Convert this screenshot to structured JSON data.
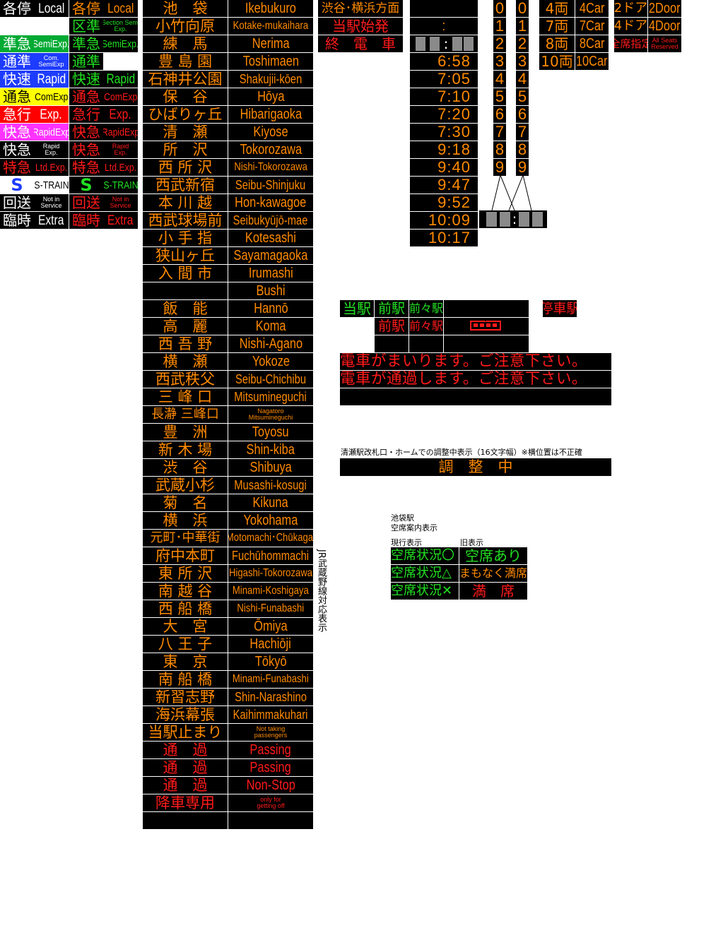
{
  "type_badges": [
    {
      "jp": "各停",
      "en": "Local",
      "jp_bg": "#000000",
      "jp_fg": "#ffffff",
      "en_bg": "#000000",
      "en_fg": "#ffffff",
      "jp_led": "各停",
      "en_led": "Local",
      "led_fg": "#ff8a00"
    },
    {
      "jp": "",
      "en": "",
      "jp_bg": "#000000",
      "jp_fg": "#ffffff",
      "en_bg": "#000000",
      "en_fg": "#ffffff",
      "jp_led": "区準",
      "en_led": "Section Semi Exp.",
      "led_fg": "#22e022"
    },
    {
      "jp": "準急",
      "en": "SemiExp.",
      "jp_bg": "#00aa33",
      "jp_fg": "#ffffff",
      "en_bg": "#00aa33",
      "en_fg": "#ffffff",
      "jp_led": "準急",
      "en_led": "SemiExp.",
      "led_fg": "#22e022"
    },
    {
      "jp": "通準",
      "en": "Com. SemiExp",
      "jp_bg": "#1e3cff",
      "jp_fg": "#ffffff",
      "en_bg": "#1e3cff",
      "en_fg": "#ffffff",
      "jp_led": "通準",
      "en_led": "",
      "led_fg": "#22e022"
    },
    {
      "jp": "快速",
      "en": "Rapid",
      "jp_bg": "#1e3cff",
      "jp_fg": "#ffffff",
      "en_bg": "#1e3cff",
      "en_fg": "#ffffff",
      "jp_led": "快速",
      "en_led": "Rapid",
      "led_fg": "#22e022"
    },
    {
      "jp": "通急",
      "en": "ComExp",
      "jp_bg": "#ffff00",
      "jp_fg": "#000000",
      "en_bg": "#ffff00",
      "en_fg": "#000000",
      "jp_led": "通急",
      "en_led": "ComExp",
      "led_fg": "#ff1a1a"
    },
    {
      "jp": "急行",
      "en": "Exp.",
      "jp_bg": "#ff0000",
      "jp_fg": "#ffffff",
      "en_bg": "#ff0000",
      "en_fg": "#ffffff",
      "jp_led": "急行",
      "en_led": "Exp.",
      "led_fg": "#ff1a1a"
    },
    {
      "jp": "快急",
      "en": "RapidExp",
      "jp_bg": "#ff33ff",
      "jp_fg": "#ffffff",
      "en_bg": "#ff33ff",
      "en_fg": "#ffffff",
      "jp_led": "快急",
      "en_led": "RapidExp",
      "led_fg": "#ff1a1a"
    },
    {
      "jp": "快急",
      "en": "Rapid Exp.",
      "jp_bg": "#000000",
      "jp_fg": "#ffffff",
      "en_bg": "#000000",
      "en_fg": "#ffffff",
      "jp_led": "快急",
      "en_led": "Rapid Exp.",
      "led_fg": "#ff1a1a"
    },
    {
      "jp": "特急",
      "en": "Ltd.Exp.",
      "jp_bg": "#000000",
      "jp_fg": "#ff1a1a",
      "en_bg": "#000000",
      "en_fg": "#ff1a1a",
      "jp_led": "特急",
      "en_led": "Ltd.Exp.",
      "led_fg": "#ff1a1a"
    },
    {
      "jp": "S",
      "en": "S-TRAIN",
      "jp_bg": "#ffffff",
      "jp_fg": "#1e3cff",
      "en_bg": "#ffffff",
      "en_fg": "#000000",
      "jp_led": "S",
      "en_led": "S-TRAIN",
      "led_fg": "#22e022"
    },
    {
      "jp": "回送",
      "en": "Not in Service",
      "jp_bg": "#000000",
      "jp_fg": "#ffffff",
      "en_bg": "#000000",
      "en_fg": "#ffffff",
      "jp_led": "回送",
      "en_led": "Not in Service",
      "led_fg": "#ff1a1a"
    },
    {
      "jp": "臨時",
      "en": "Extra",
      "jp_bg": "#000000",
      "jp_fg": "#ffffff",
      "en_bg": "#000000",
      "en_fg": "#ffffff",
      "jp_led": "臨時",
      "en_led": "Extra",
      "led_fg": "#ff1a1a"
    }
  ],
  "stations": [
    {
      "jp": "池　袋",
      "en": "Ikebukuro",
      "color": "#ff8a00"
    },
    {
      "jp": "小竹向原",
      "en": "Kotake-mukaihara",
      "color": "#ff8a00"
    },
    {
      "jp": "練　馬",
      "en": "Nerima",
      "color": "#ff8a00"
    },
    {
      "jp": "豊 島 園",
      "en": "Toshimaen",
      "color": "#ff8a00"
    },
    {
      "jp": "石神井公園",
      "en": "Shakujii-kōen",
      "color": "#ff8a00"
    },
    {
      "jp": "保　谷",
      "en": "Hōya",
      "color": "#ff8a00"
    },
    {
      "jp": "ひばりヶ丘",
      "en": "Hibarigaoka",
      "color": "#ff8a00"
    },
    {
      "jp": "清　瀬",
      "en": "Kiyose",
      "color": "#ff8a00"
    },
    {
      "jp": "所　沢",
      "en": "Tokorozawa",
      "color": "#ff8a00"
    },
    {
      "jp": "西 所 沢",
      "en": "Nishi-Tokorozawa",
      "color": "#ff8a00"
    },
    {
      "jp": "西武新宿",
      "en": "Seibu-Shinjuku",
      "color": "#ff8a00"
    },
    {
      "jp": "本 川 越",
      "en": "Hon-kawagoe",
      "color": "#ff8a00"
    },
    {
      "jp": "西武球場前",
      "en": "Seibukyūjō-mae",
      "color": "#ff8a00"
    },
    {
      "jp": "小 手 指",
      "en": "Kotesashi",
      "color": "#ff8a00"
    },
    {
      "jp": "狭山ヶ丘",
      "en": "Sayamagaoka",
      "color": "#ff8a00"
    },
    {
      "jp": "入 間 市",
      "en": "Irumashi",
      "color": "#ff8a00"
    },
    {
      "jp": "",
      "en": "Bushi",
      "color": "#ff8a00"
    },
    {
      "jp": "飯　能",
      "en": "Hannō",
      "color": "#ff8a00"
    },
    {
      "jp": "高　麗",
      "en": "Koma",
      "color": "#ff8a00"
    },
    {
      "jp": "西 吾 野",
      "en": "Nishi-Agano",
      "color": "#ff8a00"
    },
    {
      "jp": "横　瀬",
      "en": "Yokoze",
      "color": "#ff8a00"
    },
    {
      "jp": "西武秩父",
      "en": "Seibu-Chichibu",
      "color": "#ff8a00"
    },
    {
      "jp": "三 峰 口",
      "en": "Mitsumineguchi",
      "color": "#ff8a00"
    },
    {
      "jp": "長瀞 三峰口",
      "en": "Nagatoro Mitsumineguchi",
      "color": "#ff8a00"
    },
    {
      "jp": "豊　洲",
      "en": "Toyosu",
      "color": "#ff8a00"
    },
    {
      "jp": "新 木 場",
      "en": "Shin-kiba",
      "color": "#ff8a00"
    },
    {
      "jp": "渋　谷",
      "en": "Shibuya",
      "color": "#ff8a00"
    },
    {
      "jp": "武蔵小杉",
      "en": "Musashi-kosugi",
      "color": "#ff8a00"
    },
    {
      "jp": "菊　名",
      "en": "Kikuna",
      "color": "#ff8a00"
    },
    {
      "jp": "横　浜",
      "en": "Yokohama",
      "color": "#ff8a00"
    },
    {
      "jp": "元町･中華街",
      "en": "Motomachi･Chūkagai",
      "color": "#ff8a00"
    },
    {
      "jp": "府中本町",
      "en": "Fuchūhommachi",
      "color": "#ff8a00"
    },
    {
      "jp": "東 所 沢",
      "en": "Higashi-Tokorozawa",
      "color": "#ff8a00"
    },
    {
      "jp": "南 越 谷",
      "en": "Minami-Koshigaya",
      "color": "#ff8a00"
    },
    {
      "jp": "西 船 橋",
      "en": "Nishi-Funabashi",
      "color": "#ff8a00"
    },
    {
      "jp": "大　宮",
      "en": "Ōmiya",
      "color": "#ff8a00"
    },
    {
      "jp": "八 王 子",
      "en": "Hachiōji",
      "color": "#ff8a00"
    },
    {
      "jp": "東　京",
      "en": "Tōkyō",
      "color": "#ff8a00"
    },
    {
      "jp": "南 船 橋",
      "en": "Minami-Funabashi",
      "color": "#ff8a00"
    },
    {
      "jp": "新習志野",
      "en": "Shin-Narashino",
      "color": "#ff8a00"
    },
    {
      "jp": "海浜幕張",
      "en": "Kaihimmakuhari",
      "color": "#ff8a00"
    },
    {
      "jp": "当駅止まり",
      "en": "Not taking passengers",
      "color": "#ff8a00"
    },
    {
      "jp": "通　過",
      "en": "Passing",
      "color": "#ff1a1a"
    },
    {
      "jp": "通　過",
      "en": "Passing",
      "color": "#ff1a1a"
    },
    {
      "jp": "通　過",
      "en": "Non-Stop",
      "color": "#ff1a1a"
    },
    {
      "jp": "降車専用",
      "en": "only for getting off",
      "color": "#ff1a1a"
    },
    {
      "jp": "",
      "en": "",
      "color": "#ff1a1a"
    }
  ],
  "jr_note": "JR武蔵野線対応表示",
  "origin_panel": [
    {
      "text": "渋谷･横浜方面",
      "color": "#ff8a00"
    },
    {
      "text": "当駅始発",
      "color": "#ff1a1a"
    },
    {
      "text": "終　電　車",
      "color": "#ff1a1a"
    }
  ],
  "times": {
    "colon": ":",
    "grey_colon": ":",
    "values": [
      "6:58",
      "7:05",
      "7:10",
      "7:20",
      "7:30",
      "9:18",
      "9:40",
      "9:47",
      "9:52",
      "10:09",
      "10:17"
    ]
  },
  "digits": [
    "0",
    "1",
    "2",
    "3",
    "4",
    "5",
    "6",
    "7",
    "8",
    "9"
  ],
  "digit_colon": ":",
  "cars": [
    {
      "jp": "4両",
      "en": "4Car"
    },
    {
      "jp": "7両",
      "en": "7Car"
    },
    {
      "jp": "8両",
      "en": "8Car"
    },
    {
      "jp": "10両",
      "en": "10Car"
    }
  ],
  "doors": [
    {
      "jp": "2ドア",
      "en": "2Door"
    },
    {
      "jp": "4ドア",
      "en": "4Door"
    },
    {
      "jp": "全席指定",
      "en": "All Seats Reserved"
    }
  ],
  "stop_panel": {
    "this_station": "当駅",
    "prev_station": "前駅",
    "prev_prev_station": "前々駅",
    "stop_label": "停車駅"
  },
  "announcements": [
    "電車がまいります。ご注意下さい。",
    "電車が通過します。ご注意下さい。",
    ""
  ],
  "adjust_note": "清瀬駅改札口・ホームでの調整中表示（16文字幅）※横位置は不正確",
  "adjust_text": "調　整　中",
  "seat_info": {
    "title_line1": "池袋駅",
    "title_line2": "空席案内表示",
    "current_label": "現行表示",
    "old_label": "旧表示",
    "rows": [
      {
        "status": "空席状況〇",
        "old": "空席あり",
        "old_color": "#22e022"
      },
      {
        "status": "空席状況△",
        "old": "まもなく満席",
        "old_color": "#ff8a00"
      },
      {
        "status": "空席状況✕",
        "old": "満　席",
        "old_color": "#ff1a1a"
      }
    ]
  }
}
